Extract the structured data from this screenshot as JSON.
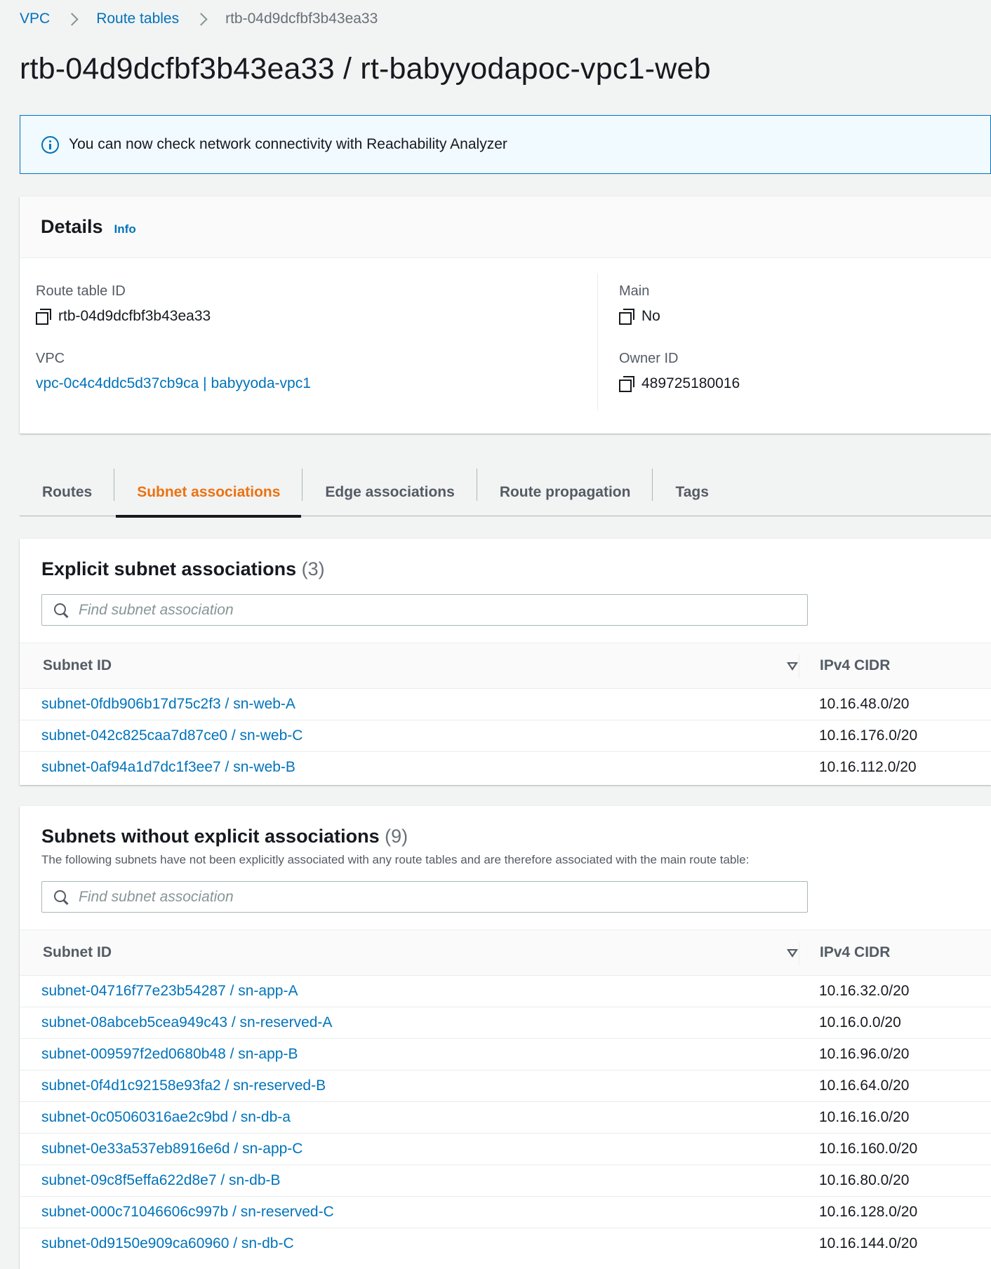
{
  "breadcrumb": {
    "items": [
      "VPC",
      "Route tables"
    ],
    "current": "rtb-04d9dcfbf3b43ea33"
  },
  "page_title": "rtb-04d9dcfbf3b43ea33 / rt-babyyodapoc-vpc1-web",
  "flash": {
    "message": "You can now check network connectivity with Reachability Analyzer"
  },
  "details": {
    "title": "Details",
    "info_label": "Info",
    "route_table_id_label": "Route table ID",
    "route_table_id": "rtb-04d9dcfbf3b43ea33",
    "vpc_label": "VPC",
    "vpc": "vpc-0c4c4ddc5d37cb9ca | babyyoda-vpc1",
    "main_label": "Main",
    "main": "No",
    "owner_id_label": "Owner ID",
    "owner_id": "489725180016"
  },
  "tabs": [
    {
      "label": "Routes",
      "active": false
    },
    {
      "label": "Subnet associations",
      "active": true
    },
    {
      "label": "Edge associations",
      "active": false
    },
    {
      "label": "Route propagation",
      "active": false
    },
    {
      "label": "Tags",
      "active": false
    }
  ],
  "explicit": {
    "title": "Explicit subnet associations",
    "count": "(3)",
    "search_placeholder": "Find subnet association",
    "col_subnet": "Subnet ID",
    "col_cidr": "IPv4 CIDR",
    "rows": [
      {
        "subnet": "subnet-0fdb906b17d75c2f3 / sn-web-A",
        "cidr": "10.16.48.0/20"
      },
      {
        "subnet": "subnet-042c825caa7d87ce0 / sn-web-C",
        "cidr": "10.16.176.0/20"
      },
      {
        "subnet": "subnet-0af94a1d7dc1f3ee7 / sn-web-B",
        "cidr": "10.16.112.0/20"
      }
    ]
  },
  "implicit": {
    "title": "Subnets without explicit associations",
    "count": "(9)",
    "description": "The following subnets have not been explicitly associated with any route tables and are therefore associated with the main route table:",
    "search_placeholder": "Find subnet association",
    "col_subnet": "Subnet ID",
    "col_cidr": "IPv4 CIDR",
    "rows": [
      {
        "subnet": "subnet-04716f77e23b54287 / sn-app-A",
        "cidr": "10.16.32.0/20"
      },
      {
        "subnet": "subnet-08abceb5cea949c43 / sn-reserved-A",
        "cidr": "10.16.0.0/20"
      },
      {
        "subnet": "subnet-009597f2ed0680b48 / sn-app-B",
        "cidr": "10.16.96.0/20"
      },
      {
        "subnet": "subnet-0f4d1c92158e93fa2 / sn-reserved-B",
        "cidr": "10.16.64.0/20"
      },
      {
        "subnet": "subnet-0c05060316ae2c9bd / sn-db-a",
        "cidr": "10.16.16.0/20"
      },
      {
        "subnet": "subnet-0e33a537eb8916e6d / sn-app-C",
        "cidr": "10.16.160.0/20"
      },
      {
        "subnet": "subnet-09c8f5effa622d8e7 / sn-db-B",
        "cidr": "10.16.80.0/20"
      },
      {
        "subnet": "subnet-000c71046606c997b / sn-reserved-C",
        "cidr": "10.16.128.0/20"
      },
      {
        "subnet": "subnet-0d9150e909ca60960 / sn-db-C",
        "cidr": "10.16.144.0/20"
      }
    ]
  },
  "colors": {
    "link": "#0073bb",
    "active_tab": "#ec7211",
    "background": "#f2f3f3"
  }
}
